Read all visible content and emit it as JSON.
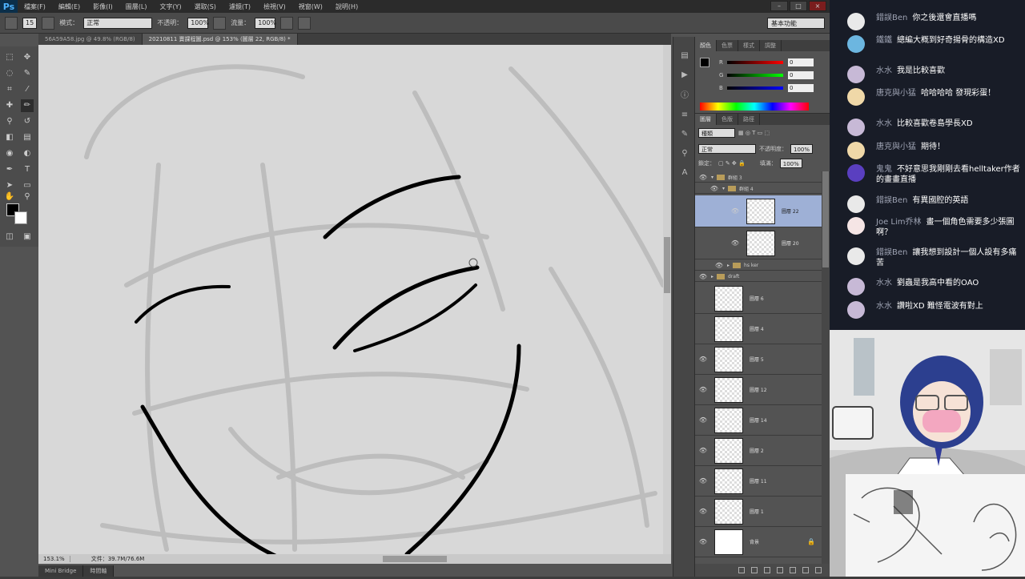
{
  "menubar": {
    "logo": "Ps",
    "items": [
      "檔案(F)",
      "編輯(E)",
      "影像(I)",
      "圖層(L)",
      "文字(Y)",
      "選取(S)",
      "濾鏡(T)",
      "檢視(V)",
      "視窗(W)",
      "說明(H)"
    ],
    "window_buttons": [
      "–",
      "□",
      "×"
    ]
  },
  "options": {
    "brush_size": "15",
    "mode_label": "模式：",
    "mode_value": "正常",
    "opacity_label": "不透明：",
    "opacity_value": "100%",
    "flow_label": "流量：",
    "flow_value": "100%",
    "workspace": "基本功能"
  },
  "doc_tabs": [
    "56A59A58.jpg @ 49.8% (RGB/8)",
    "20210811 賣課程圖.psd @ 153% (圖層 22, RGB/8) *"
  ],
  "status": {
    "zoom": "153.1%",
    "doc_size": "文件：39.7M/76.6M"
  },
  "bottom_tabs": [
    "Mini Bridge",
    "時間軸"
  ],
  "color_panel": {
    "tabs": [
      "顏色",
      "色票",
      "樣式",
      "調整"
    ],
    "sliders": [
      {
        "letter": "R",
        "value": "0",
        "gradient": "linear-gradient(to right,#000,#f00)"
      },
      {
        "letter": "G",
        "value": "0",
        "gradient": "linear-gradient(to right,#000,#0f0)"
      },
      {
        "letter": "B",
        "value": "0",
        "gradient": "linear-gradient(to right,#000,#00f)"
      }
    ]
  },
  "layers_panel": {
    "tabs": [
      "圖層",
      "色版",
      "路徑"
    ],
    "kind_filter": "種類",
    "blend_mode": "正常",
    "opacity_label": "不透明度：",
    "opacity_value": "100%",
    "lock_label": "鎖定：",
    "fill_label": "填滿：",
    "fill_value": "100%",
    "groups": [
      {
        "name": "群組 3",
        "indent": 0
      },
      {
        "name": "群組 4",
        "indent": 1
      }
    ],
    "layers": [
      {
        "name": "圖層 22",
        "selected": true
      },
      {
        "name": "圖層 20",
        "selected": false
      },
      {
        "name": "hs ker",
        "group": true
      },
      {
        "name": "draft",
        "group": true
      },
      {
        "name": "圖層 6",
        "selected": false
      },
      {
        "name": "圖層 4",
        "selected": false
      },
      {
        "name": "圖層 5",
        "selected": false
      },
      {
        "name": "圖層 12",
        "selected": false
      },
      {
        "name": "圖層 14",
        "selected": false
      },
      {
        "name": "圖層 2",
        "selected": false
      },
      {
        "name": "圖層 11",
        "selected": false
      },
      {
        "name": "圖層 1",
        "selected": false
      },
      {
        "name": "背景",
        "selected": false
      }
    ]
  },
  "chat": {
    "messages": [
      {
        "user": "錯誤Ben",
        "text": "你之後還會直播嗎",
        "avatar": "#e9e9e9"
      },
      {
        "user": "鐵鐵",
        "text": "總編大概到好奇揚骨的構造XD",
        "avatar": "#6cb6e0"
      },
      {
        "user": "水水",
        "text": "我是比較喜歡",
        "avatar": "#c7b9d6"
      },
      {
        "user": "唐克與小猛",
        "text": "哈哈哈哈 發現彩蛋！",
        "avatar": "#f0d8a8"
      },
      {
        "user": "水水",
        "text": "比較喜歡卷島學長XD",
        "avatar": "#c7b9d6"
      },
      {
        "user": "唐克與小猛",
        "text": "期待！",
        "avatar": "#f0d8a8"
      },
      {
        "user": "鬼鬼",
        "text": "不好意思我剛剛去看helltaker作者的畫畫直播",
        "avatar": "#5a3fc0"
      },
      {
        "user": "錯誤Ben",
        "text": "有異國腔的英語",
        "avatar": "#e9e9e9"
      },
      {
        "user": "Joe Lim乔林",
        "text": "畫一個角色需要多少張圖啊？",
        "avatar": "#f5e5e5"
      },
      {
        "user": "錯誤Ben",
        "text": "讓我想到設計一個人設有多痛苦",
        "avatar": "#e9e9e9"
      },
      {
        "user": "水水",
        "text": "劉蟲是我高中看的OAO",
        "avatar": "#c7b9d6"
      },
      {
        "user": "水水",
        "text": "讚啦XD 難怪電波有對上",
        "avatar": "#c7b9d6"
      }
    ]
  }
}
